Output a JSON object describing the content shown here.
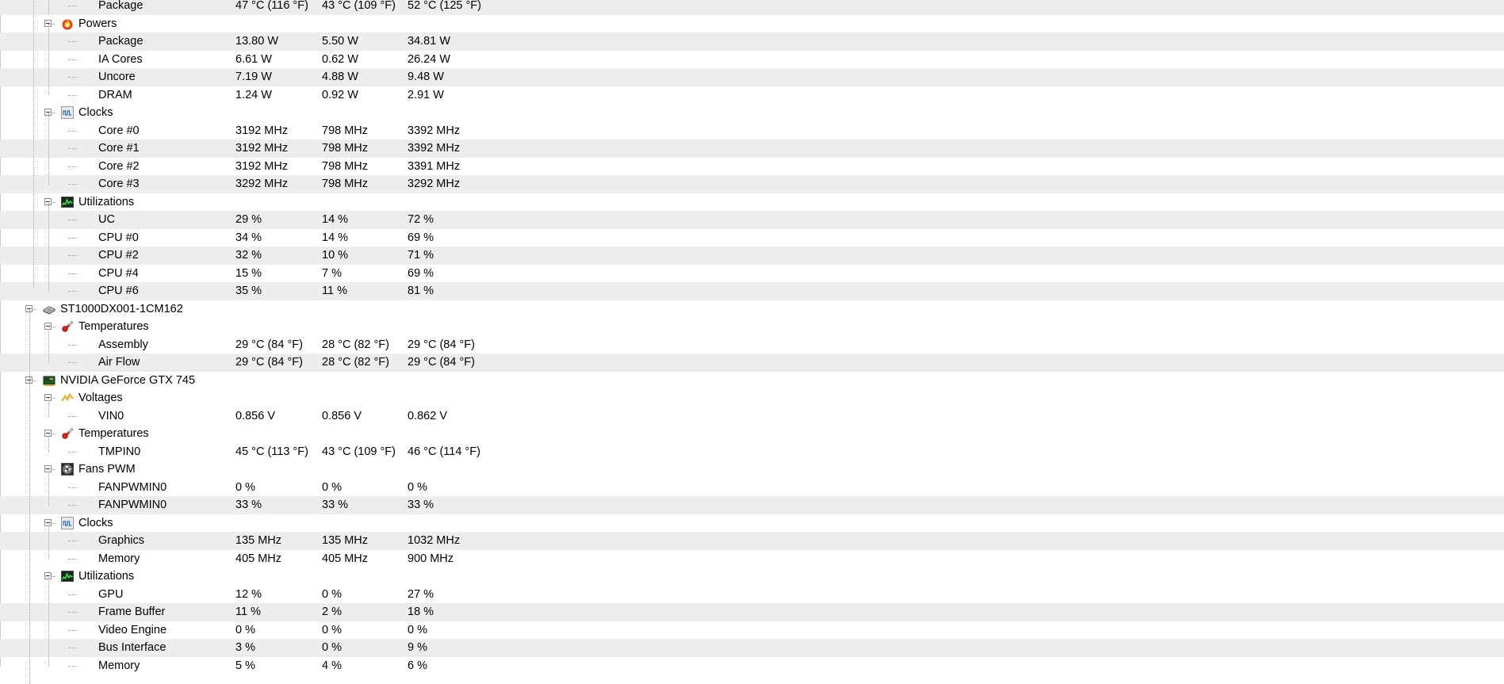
{
  "rows": [
    {
      "type": "sensor",
      "label": "Package",
      "v": [
        "47 °C (116 °F)",
        "43 °C (109 °F)",
        "52 °C (125 °F)"
      ]
    },
    {
      "type": "group",
      "label": "Powers",
      "icon": "flame-icon"
    },
    {
      "type": "sensor",
      "label": "Package",
      "v": [
        "13.80 W",
        "5.50 W",
        "34.81 W"
      ]
    },
    {
      "type": "sensor",
      "label": "IA Cores",
      "v": [
        "6.61 W",
        "0.62 W",
        "26.24 W"
      ]
    },
    {
      "type": "sensor",
      "label": "Uncore",
      "v": [
        "7.19 W",
        "4.88 W",
        "9.48 W"
      ]
    },
    {
      "type": "sensor",
      "label": "DRAM",
      "v": [
        "1.24 W",
        "0.92 W",
        "2.91 W"
      ]
    },
    {
      "type": "group",
      "label": "Clocks",
      "icon": "clock-wave-icon"
    },
    {
      "type": "sensor",
      "label": "Core #0",
      "v": [
        "3192 MHz",
        "798 MHz",
        "3392 MHz"
      ]
    },
    {
      "type": "sensor",
      "label": "Core #1",
      "v": [
        "3192 MHz",
        "798 MHz",
        "3392 MHz"
      ]
    },
    {
      "type": "sensor",
      "label": "Core #2",
      "v": [
        "3192 MHz",
        "798 MHz",
        "3391 MHz"
      ]
    },
    {
      "type": "sensor",
      "label": "Core #3",
      "v": [
        "3292 MHz",
        "798 MHz",
        "3292 MHz"
      ]
    },
    {
      "type": "group",
      "label": "Utilizations",
      "icon": "utilization-graph-icon"
    },
    {
      "type": "sensor",
      "label": "UC",
      "v": [
        "29 %",
        "14 %",
        "72 %"
      ]
    },
    {
      "type": "sensor",
      "label": "CPU #0",
      "v": [
        "34 %",
        "14 %",
        "69 %"
      ]
    },
    {
      "type": "sensor",
      "label": "CPU #2",
      "v": [
        "32 %",
        "10 %",
        "71 %"
      ]
    },
    {
      "type": "sensor",
      "label": "CPU #4",
      "v": [
        "15 %",
        "7 %",
        "69 %"
      ]
    },
    {
      "type": "sensor",
      "label": "CPU #6",
      "v": [
        "35 %",
        "11 %",
        "81 %"
      ]
    },
    {
      "type": "device",
      "label": "ST1000DX001-1CM162",
      "icon": "hard-drive-icon"
    },
    {
      "type": "group",
      "label": "Temperatures",
      "icon": "thermometer-icon"
    },
    {
      "type": "sensor",
      "label": "Assembly",
      "v": [
        "29 °C  (84 °F)",
        "28 °C  (82 °F)",
        "29 °C  (84 °F)"
      ]
    },
    {
      "type": "sensor",
      "label": "Air Flow",
      "v": [
        "29 °C  (84 °F)",
        "28 °C  (82 °F)",
        "29 °C  (84 °F)"
      ]
    },
    {
      "type": "device",
      "label": "NVIDIA GeForce GTX 745",
      "icon": "graphics-card-icon"
    },
    {
      "type": "group",
      "label": "Voltages",
      "icon": "voltage-icon"
    },
    {
      "type": "sensor",
      "label": "VIN0",
      "v": [
        "0.856 V",
        "0.856 V",
        "0.862 V"
      ]
    },
    {
      "type": "group",
      "label": "Temperatures",
      "icon": "thermometer-icon"
    },
    {
      "type": "sensor",
      "label": "TMPIN0",
      "v": [
        "45 °C  (113 °F)",
        "43 °C  (109 °F)",
        "46 °C  (114 °F)"
      ]
    },
    {
      "type": "group",
      "label": "Fans PWM",
      "icon": "fan-icon"
    },
    {
      "type": "sensor",
      "label": "FANPWMIN0",
      "v": [
        "0 %",
        "0 %",
        "0 %"
      ]
    },
    {
      "type": "sensor",
      "label": "FANPWMIN0",
      "v": [
        "33 %",
        "33 %",
        "33 %"
      ]
    },
    {
      "type": "group",
      "label": "Clocks",
      "icon": "clock-wave-icon"
    },
    {
      "type": "sensor",
      "label": "Graphics",
      "v": [
        "135 MHz",
        "135 MHz",
        "1032 MHz"
      ]
    },
    {
      "type": "sensor",
      "label": "Memory",
      "v": [
        "405 MHz",
        "405 MHz",
        "900 MHz"
      ]
    },
    {
      "type": "group",
      "label": "Utilizations",
      "icon": "utilization-graph-icon"
    },
    {
      "type": "sensor",
      "label": "GPU",
      "v": [
        "12 %",
        "0 %",
        "27 %"
      ]
    },
    {
      "type": "sensor",
      "label": "Frame Buffer",
      "v": [
        "11 %",
        "2 %",
        "18 %"
      ]
    },
    {
      "type": "sensor",
      "label": "Video Engine",
      "v": [
        "0 %",
        "0 %",
        "0 %"
      ]
    },
    {
      "type": "sensor",
      "label": "Bus Interface",
      "v": [
        "3 %",
        "0 %",
        "9 %"
      ]
    },
    {
      "type": "sensor",
      "label": "Memory",
      "v": [
        "5 %",
        "4 %",
        "6 %"
      ]
    }
  ]
}
